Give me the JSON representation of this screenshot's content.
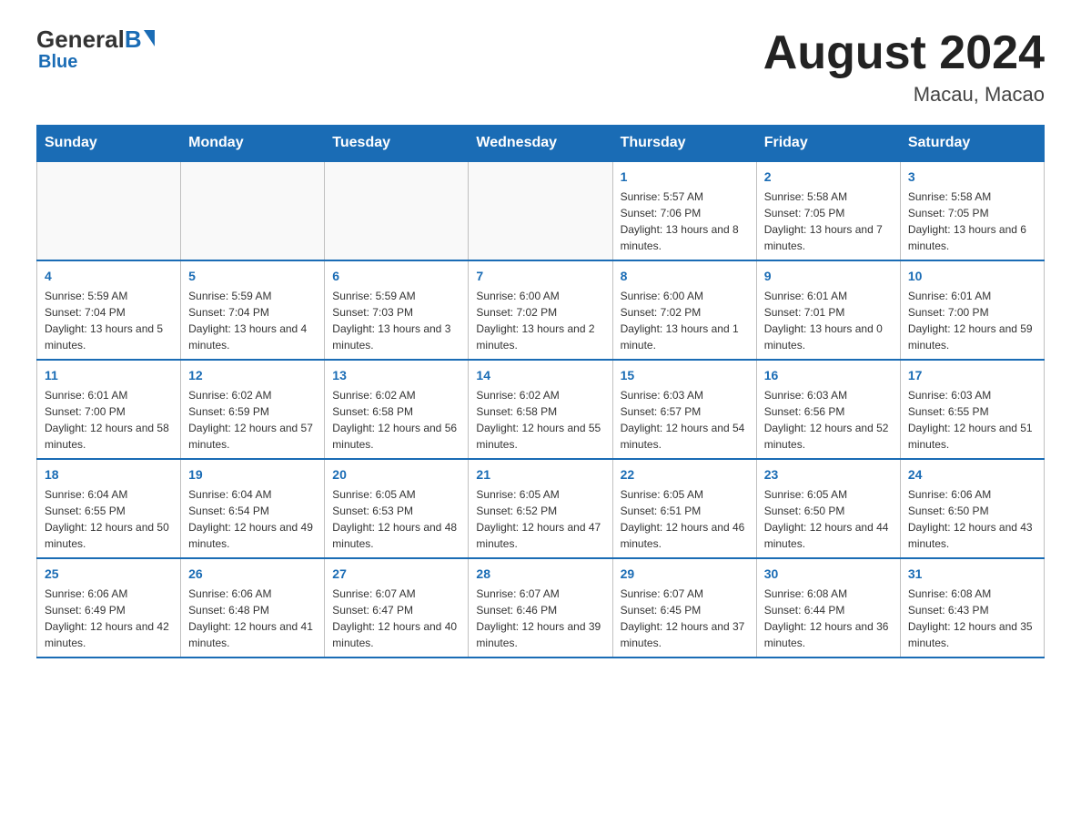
{
  "logo": {
    "general": "General",
    "blue": "Blue"
  },
  "title": "August 2024",
  "location": "Macau, Macao",
  "days_of_week": [
    "Sunday",
    "Monday",
    "Tuesday",
    "Wednesday",
    "Thursday",
    "Friday",
    "Saturday"
  ],
  "weeks": [
    [
      {
        "day": "",
        "info": ""
      },
      {
        "day": "",
        "info": ""
      },
      {
        "day": "",
        "info": ""
      },
      {
        "day": "",
        "info": ""
      },
      {
        "day": "1",
        "info": "Sunrise: 5:57 AM\nSunset: 7:06 PM\nDaylight: 13 hours and 8 minutes."
      },
      {
        "day": "2",
        "info": "Sunrise: 5:58 AM\nSunset: 7:05 PM\nDaylight: 13 hours and 7 minutes."
      },
      {
        "day": "3",
        "info": "Sunrise: 5:58 AM\nSunset: 7:05 PM\nDaylight: 13 hours and 6 minutes."
      }
    ],
    [
      {
        "day": "4",
        "info": "Sunrise: 5:59 AM\nSunset: 7:04 PM\nDaylight: 13 hours and 5 minutes."
      },
      {
        "day": "5",
        "info": "Sunrise: 5:59 AM\nSunset: 7:04 PM\nDaylight: 13 hours and 4 minutes."
      },
      {
        "day": "6",
        "info": "Sunrise: 5:59 AM\nSunset: 7:03 PM\nDaylight: 13 hours and 3 minutes."
      },
      {
        "day": "7",
        "info": "Sunrise: 6:00 AM\nSunset: 7:02 PM\nDaylight: 13 hours and 2 minutes."
      },
      {
        "day": "8",
        "info": "Sunrise: 6:00 AM\nSunset: 7:02 PM\nDaylight: 13 hours and 1 minute."
      },
      {
        "day": "9",
        "info": "Sunrise: 6:01 AM\nSunset: 7:01 PM\nDaylight: 13 hours and 0 minutes."
      },
      {
        "day": "10",
        "info": "Sunrise: 6:01 AM\nSunset: 7:00 PM\nDaylight: 12 hours and 59 minutes."
      }
    ],
    [
      {
        "day": "11",
        "info": "Sunrise: 6:01 AM\nSunset: 7:00 PM\nDaylight: 12 hours and 58 minutes."
      },
      {
        "day": "12",
        "info": "Sunrise: 6:02 AM\nSunset: 6:59 PM\nDaylight: 12 hours and 57 minutes."
      },
      {
        "day": "13",
        "info": "Sunrise: 6:02 AM\nSunset: 6:58 PM\nDaylight: 12 hours and 56 minutes."
      },
      {
        "day": "14",
        "info": "Sunrise: 6:02 AM\nSunset: 6:58 PM\nDaylight: 12 hours and 55 minutes."
      },
      {
        "day": "15",
        "info": "Sunrise: 6:03 AM\nSunset: 6:57 PM\nDaylight: 12 hours and 54 minutes."
      },
      {
        "day": "16",
        "info": "Sunrise: 6:03 AM\nSunset: 6:56 PM\nDaylight: 12 hours and 52 minutes."
      },
      {
        "day": "17",
        "info": "Sunrise: 6:03 AM\nSunset: 6:55 PM\nDaylight: 12 hours and 51 minutes."
      }
    ],
    [
      {
        "day": "18",
        "info": "Sunrise: 6:04 AM\nSunset: 6:55 PM\nDaylight: 12 hours and 50 minutes."
      },
      {
        "day": "19",
        "info": "Sunrise: 6:04 AM\nSunset: 6:54 PM\nDaylight: 12 hours and 49 minutes."
      },
      {
        "day": "20",
        "info": "Sunrise: 6:05 AM\nSunset: 6:53 PM\nDaylight: 12 hours and 48 minutes."
      },
      {
        "day": "21",
        "info": "Sunrise: 6:05 AM\nSunset: 6:52 PM\nDaylight: 12 hours and 47 minutes."
      },
      {
        "day": "22",
        "info": "Sunrise: 6:05 AM\nSunset: 6:51 PM\nDaylight: 12 hours and 46 minutes."
      },
      {
        "day": "23",
        "info": "Sunrise: 6:05 AM\nSunset: 6:50 PM\nDaylight: 12 hours and 44 minutes."
      },
      {
        "day": "24",
        "info": "Sunrise: 6:06 AM\nSunset: 6:50 PM\nDaylight: 12 hours and 43 minutes."
      }
    ],
    [
      {
        "day": "25",
        "info": "Sunrise: 6:06 AM\nSunset: 6:49 PM\nDaylight: 12 hours and 42 minutes."
      },
      {
        "day": "26",
        "info": "Sunrise: 6:06 AM\nSunset: 6:48 PM\nDaylight: 12 hours and 41 minutes."
      },
      {
        "day": "27",
        "info": "Sunrise: 6:07 AM\nSunset: 6:47 PM\nDaylight: 12 hours and 40 minutes."
      },
      {
        "day": "28",
        "info": "Sunrise: 6:07 AM\nSunset: 6:46 PM\nDaylight: 12 hours and 39 minutes."
      },
      {
        "day": "29",
        "info": "Sunrise: 6:07 AM\nSunset: 6:45 PM\nDaylight: 12 hours and 37 minutes."
      },
      {
        "day": "30",
        "info": "Sunrise: 6:08 AM\nSunset: 6:44 PM\nDaylight: 12 hours and 36 minutes."
      },
      {
        "day": "31",
        "info": "Sunrise: 6:08 AM\nSunset: 6:43 PM\nDaylight: 12 hours and 35 minutes."
      }
    ]
  ]
}
